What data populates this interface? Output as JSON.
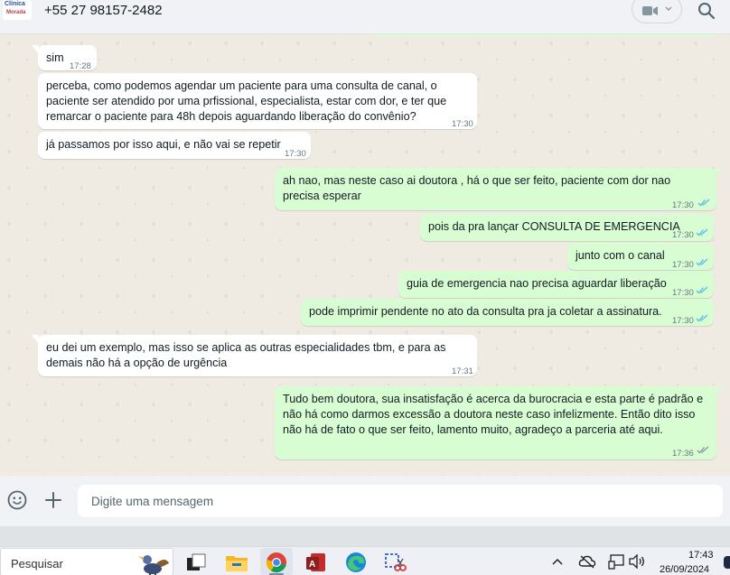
{
  "header": {
    "avatar_text_top": "Clínica",
    "avatar_text_bottom": "Morada",
    "contact": "+55 27 98157-2482"
  },
  "messages": [
    {
      "dir": "in",
      "text": "sim",
      "time": "17:28"
    },
    {
      "dir": "in",
      "text": "perceba, como podemos agendar um paciente para uma consulta de canal, o paciente ser atendido por uma prfissional, especialista, estar com dor, e ter que remarcar o paciente para 48h depois aguardando liberação do convênio?",
      "time": "17:30"
    },
    {
      "dir": "in",
      "text": "já passamos por isso aqui, e não vai se repetir",
      "time": "17:30"
    },
    {
      "dir": "out",
      "text": "ah nao, mas neste caso ai doutora , há o que ser feito, paciente com dor nao precisa esperar",
      "time": "17:30"
    },
    {
      "dir": "out",
      "text": "pois da pra lançar CONSULTA DE EMERGENCIA",
      "time": "17:30"
    },
    {
      "dir": "out",
      "text": "junto com o canal",
      "time": "17:30"
    },
    {
      "dir": "out",
      "text": "guia de emergencia nao precisa aguardar liberação",
      "time": "17:30"
    },
    {
      "dir": "out",
      "text": "pode imprimir pendente no ato da consulta pra ja coletar a assinatura.",
      "time": "17:30"
    },
    {
      "dir": "in",
      "text": "eu dei um exemplo, mas isso se aplica as outras especialidades tbm, e para as demais não há a opção de urgência",
      "time": "17:31"
    },
    {
      "dir": "out",
      "text": "Tudo bem doutora, sua insatisfação é acerca da burocracia e esta parte é padrão e não há como darmos excessão a doutora neste caso infelizmente. Então dito isso não há de fato o que ser feito, lamento muito, agradeço a parceria até aqui.",
      "time": "17:36"
    }
  ],
  "input": {
    "placeholder": "Digite uma mensagem"
  },
  "taskbar": {
    "search_label": "Pesquisar",
    "time": "17:43",
    "date": "26/09/2024"
  },
  "colors": {
    "incoming": "#ffffff",
    "outgoing": "#d9fdd3",
    "ticks": "#53bdeb",
    "chat_bg": "#efeae2"
  }
}
